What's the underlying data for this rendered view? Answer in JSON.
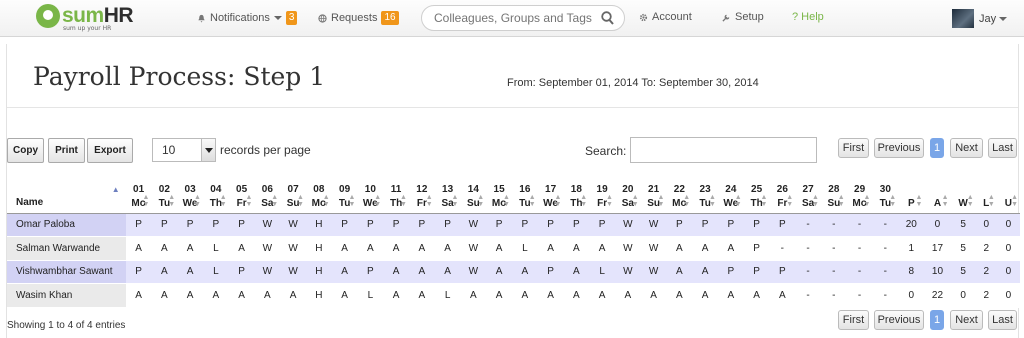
{
  "topnav": {
    "logo_brand_left": "sum",
    "logo_brand_right": "HR",
    "logo_tagline": "sum up your HR",
    "notifications": {
      "label": "Notifications",
      "count": "3"
    },
    "requests": {
      "label": "Requests",
      "count": "16"
    },
    "search_placeholder": "Colleagues, Groups and Tags",
    "account": "Account",
    "setup": "Setup",
    "help": "? Help",
    "user": "Jay"
  },
  "page": {
    "title": "Payroll Process: Step 1",
    "date_range": "From: September 01, 2014 To: September 30, 2014"
  },
  "toolbar": {
    "copy": "Copy",
    "print": "Print",
    "export": "Export"
  },
  "length_menu": {
    "value": "10",
    "label": "records per page"
  },
  "search": {
    "label": "Search:",
    "value": ""
  },
  "pagination": {
    "first": "First",
    "previous": "Previous",
    "current": "1",
    "next": "Next",
    "last": "Last"
  },
  "table": {
    "name_header": "Name",
    "days": [
      {
        "d": "01",
        "w": "Mo"
      },
      {
        "d": "02",
        "w": "Tu"
      },
      {
        "d": "03",
        "w": "We"
      },
      {
        "d": "04",
        "w": "Th"
      },
      {
        "d": "05",
        "w": "Fr"
      },
      {
        "d": "06",
        "w": "Sa"
      },
      {
        "d": "07",
        "w": "Su"
      },
      {
        "d": "08",
        "w": "Mo"
      },
      {
        "d": "09",
        "w": "Tu"
      },
      {
        "d": "10",
        "w": "We"
      },
      {
        "d": "11",
        "w": "Th"
      },
      {
        "d": "12",
        "w": "Fr"
      },
      {
        "d": "13",
        "w": "Sa"
      },
      {
        "d": "14",
        "w": "Su"
      },
      {
        "d": "15",
        "w": "Mo"
      },
      {
        "d": "16",
        "w": "Tu"
      },
      {
        "d": "17",
        "w": "We"
      },
      {
        "d": "18",
        "w": "Th"
      },
      {
        "d": "19",
        "w": "Fr"
      },
      {
        "d": "20",
        "w": "Sa"
      },
      {
        "d": "21",
        "w": "Su"
      },
      {
        "d": "22",
        "w": "Mo"
      },
      {
        "d": "23",
        "w": "Tu"
      },
      {
        "d": "24",
        "w": "We"
      },
      {
        "d": "25",
        "w": "Th"
      },
      {
        "d": "26",
        "w": "Fr"
      },
      {
        "d": "27",
        "w": "Sa"
      },
      {
        "d": "28",
        "w": "Su"
      },
      {
        "d": "29",
        "w": "Mo"
      },
      {
        "d": "30",
        "w": "Tu"
      }
    ],
    "summary_headers": [
      "P",
      "A",
      "W",
      "L",
      "U"
    ],
    "rows": [
      {
        "name": "Omar Paloba",
        "days": [
          "P",
          "P",
          "P",
          "P",
          "P",
          "W",
          "W",
          "H",
          "P",
          "P",
          "P",
          "P",
          "P",
          "W",
          "P",
          "P",
          "P",
          "P",
          "P",
          "W",
          "W",
          "P",
          "P",
          "P",
          "P",
          "P",
          "-",
          "-",
          "-",
          "-"
        ],
        "summary": [
          "20",
          "0",
          "5",
          "0",
          "0"
        ]
      },
      {
        "name": "Salman Warwande",
        "days": [
          "A",
          "A",
          "A",
          "L",
          "A",
          "W",
          "W",
          "H",
          "A",
          "A",
          "A",
          "A",
          "A",
          "W",
          "A",
          "L",
          "A",
          "A",
          "A",
          "W",
          "W",
          "A",
          "A",
          "A",
          "P",
          "-",
          "-",
          "-",
          "-",
          "-"
        ],
        "summary": [
          "1",
          "17",
          "5",
          "2",
          "0"
        ]
      },
      {
        "name": "Vishwambhar Sawant",
        "days": [
          "P",
          "A",
          "A",
          "L",
          "P",
          "W",
          "W",
          "H",
          "A",
          "P",
          "A",
          "A",
          "A",
          "W",
          "A",
          "A",
          "P",
          "A",
          "L",
          "W",
          "W",
          "A",
          "A",
          "P",
          "P",
          "P",
          "-",
          "-",
          "-",
          "-"
        ],
        "summary": [
          "8",
          "10",
          "5",
          "2",
          "0"
        ]
      },
      {
        "name": "Wasim Khan",
        "days": [
          "A",
          "A",
          "A",
          "A",
          "A",
          "A",
          "A",
          "H",
          "A",
          "L",
          "A",
          "A",
          "L",
          "A",
          "A",
          "A",
          "A",
          "A",
          "A",
          "A",
          "A",
          "A",
          "A",
          "A",
          "A",
          "A",
          "-",
          "-",
          "-",
          "-"
        ],
        "summary": [
          "0",
          "22",
          "0",
          "2",
          "0"
        ]
      }
    ]
  },
  "footer": {
    "info": "Showing 1 to 4 of 4 entries"
  },
  "colors": {
    "accent_green": "#7ab648",
    "badge_orange": "#f0961a",
    "row_highlight": "#e4e4fc",
    "page_active": "#7aa6e8"
  }
}
